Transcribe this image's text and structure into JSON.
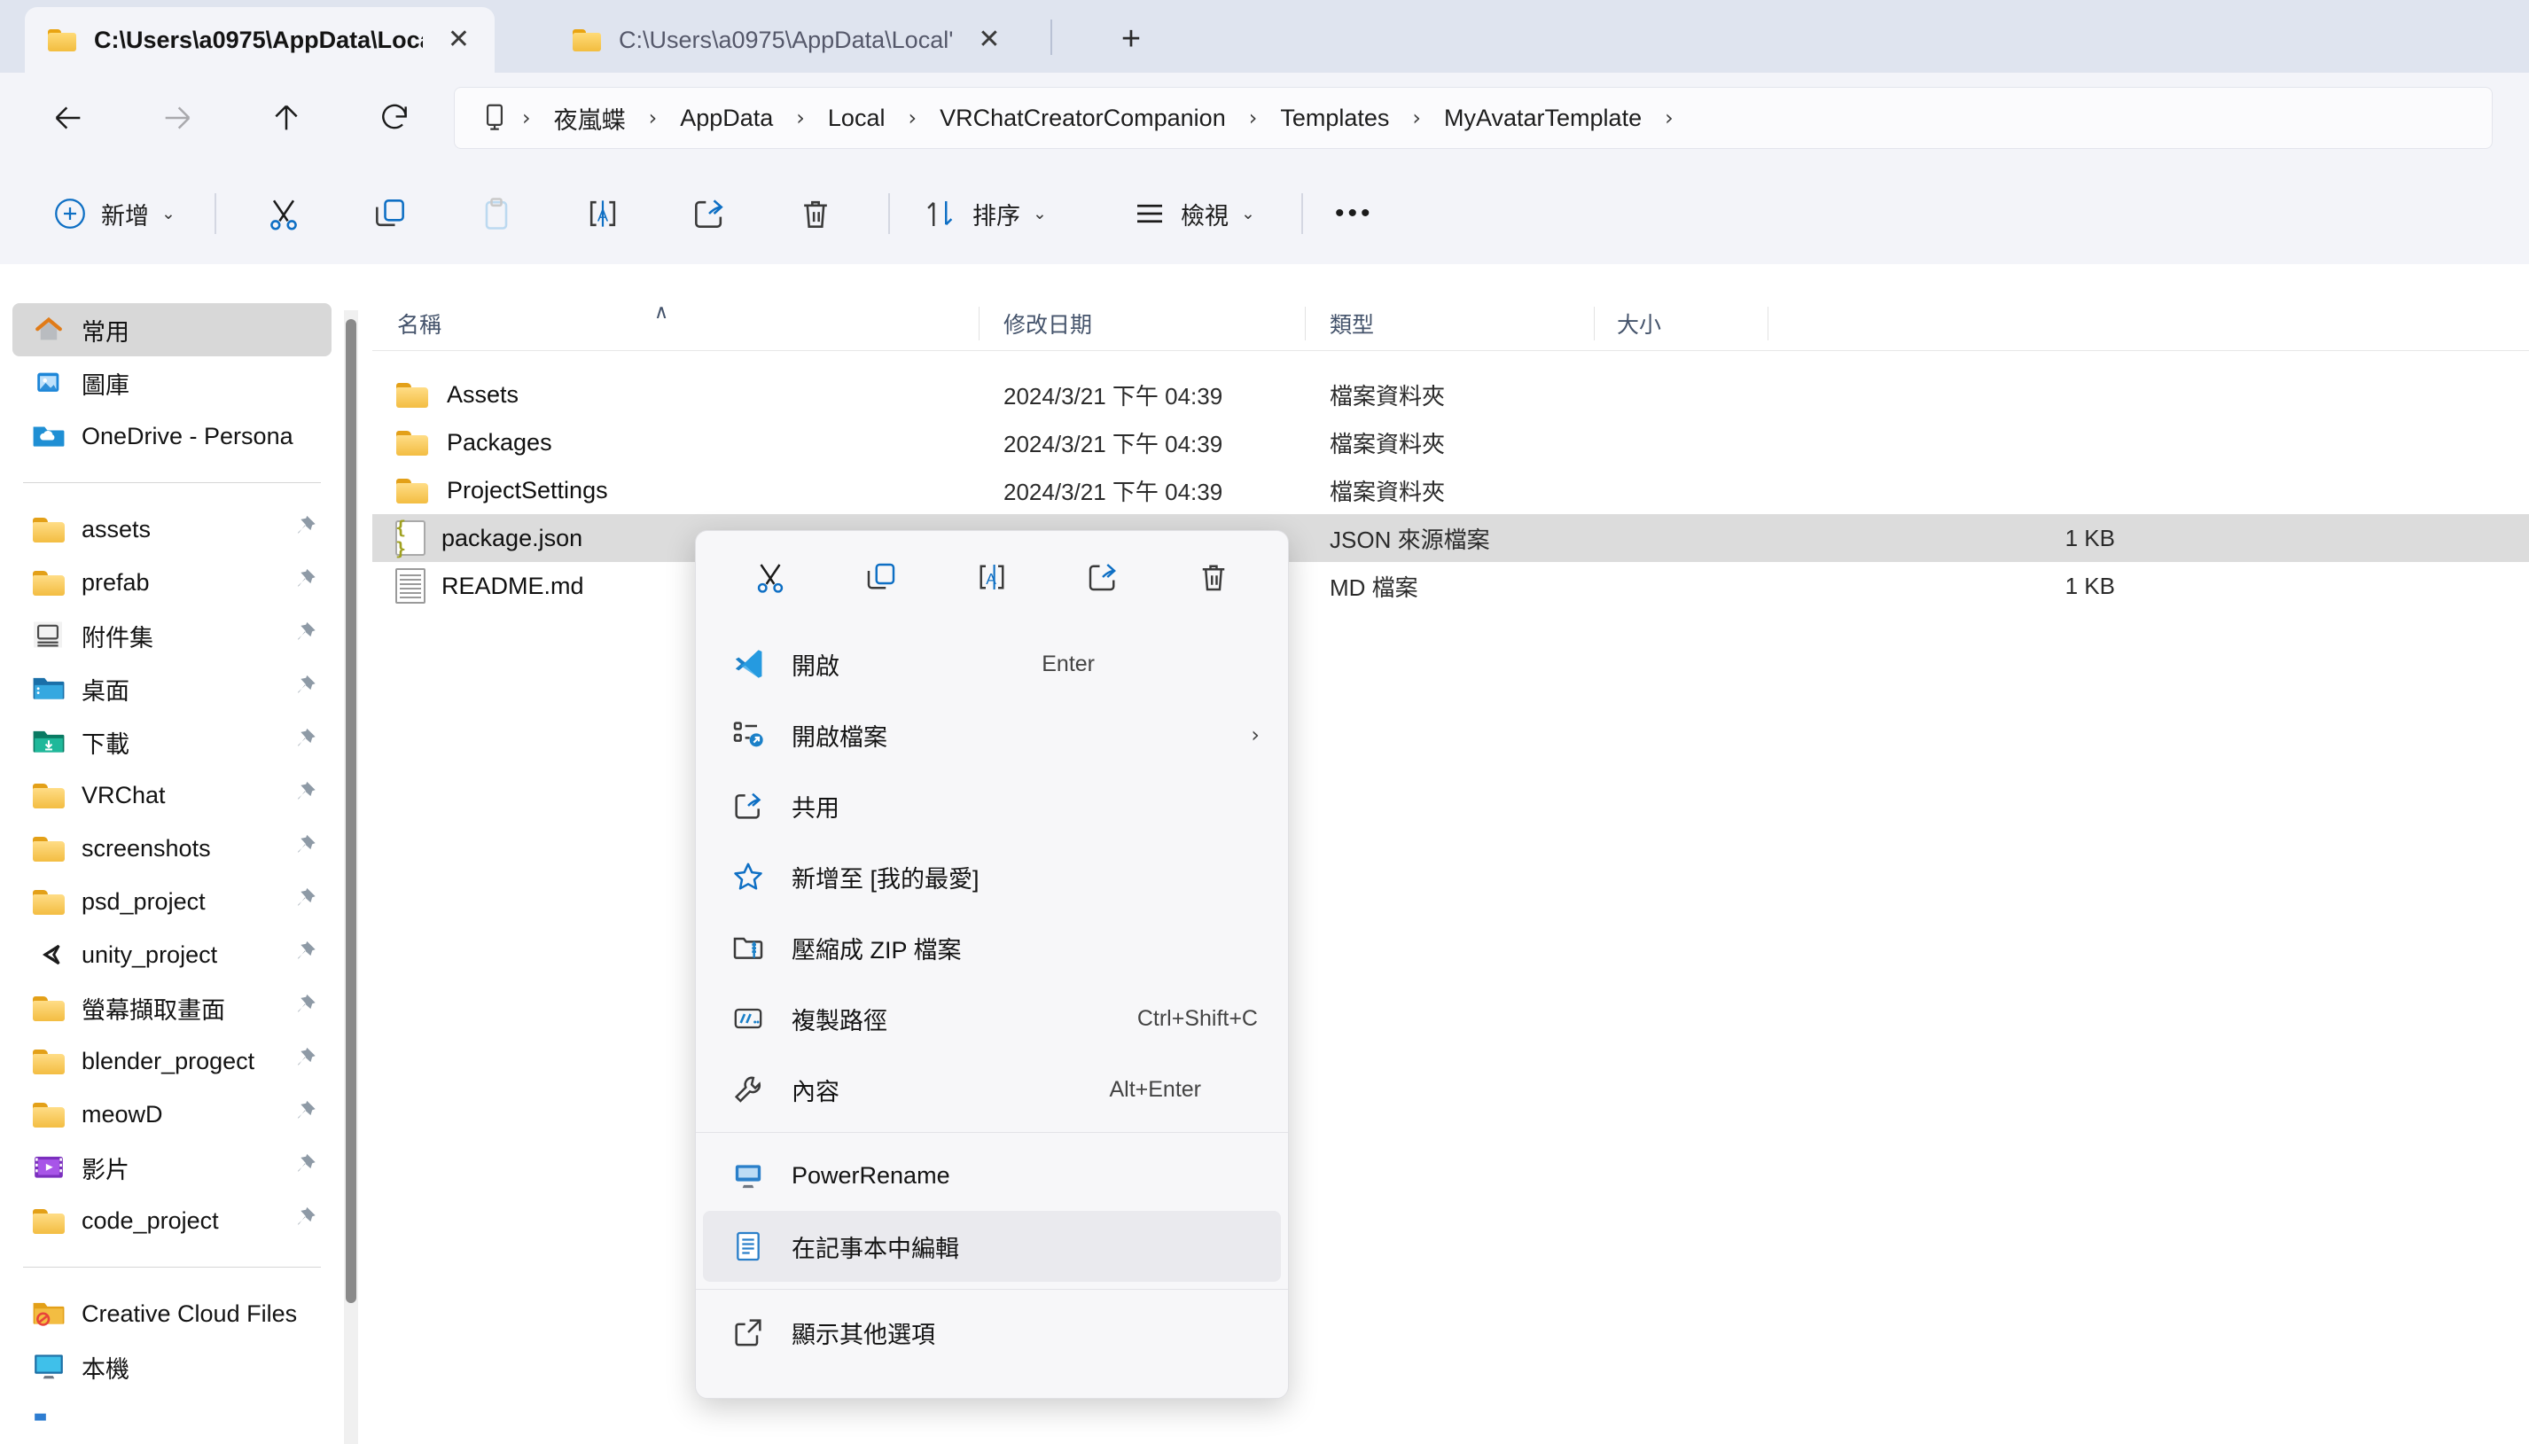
{
  "window": {
    "tabs": [
      {
        "label": "C:\\Users\\a0975\\AppData\\Loca",
        "icon": "folder-icon",
        "active": true,
        "close": "✕"
      },
      {
        "label": "C:\\Users\\a0975\\AppData\\Local'",
        "icon": "folder-icon",
        "active": false,
        "close": "✕"
      }
    ],
    "new_tab_label": "+"
  },
  "nav": {
    "back": "back-arrow",
    "forward": "forward-arrow",
    "up": "up-arrow",
    "refresh": "refresh-icon",
    "breadcrumb": [
      {
        "label": "",
        "icon": "this-pc-icon"
      },
      {
        "label": "夜嵐蝶"
      },
      {
        "label": "AppData"
      },
      {
        "label": "Local"
      },
      {
        "label": "VRChatCreatorCompanion"
      },
      {
        "label": "Templates"
      },
      {
        "label": "MyAvatarTemplate"
      }
    ],
    "separator": "›"
  },
  "toolbar": {
    "new_label": "新增",
    "new_chevron": "⌄",
    "cut_label": "剪下",
    "copy_label": "複製",
    "paste_label": "貼上",
    "rename_label": "重新命名",
    "share_label": "共用",
    "delete_label": "刪除",
    "sort_label": "排序",
    "sort_chevron": "⌄",
    "view_label": "檢視",
    "view_chevron": "⌄",
    "more_label": "•••"
  },
  "sidebar": {
    "items": [
      {
        "label": "常用",
        "icon": "home-icon",
        "selected": true,
        "pinned": false
      },
      {
        "label": "圖庫",
        "icon": "gallery-icon",
        "selected": false,
        "pinned": false
      },
      {
        "label": "OneDrive - Persona",
        "icon": "onedrive-icon",
        "selected": false,
        "pinned": false
      }
    ],
    "pinned": [
      {
        "label": "assets",
        "icon": "folder-icon",
        "pinned": true
      },
      {
        "label": "prefab",
        "icon": "folder-icon",
        "pinned": true
      },
      {
        "label": "附件集",
        "icon": "attachments-icon",
        "pinned": true
      },
      {
        "label": "桌面",
        "icon": "desktop-folder-icon",
        "pinned": true
      },
      {
        "label": "下載",
        "icon": "downloads-folder-icon",
        "pinned": true
      },
      {
        "label": "VRChat",
        "icon": "folder-icon",
        "pinned": true
      },
      {
        "label": "screenshots",
        "icon": "folder-icon",
        "pinned": true
      },
      {
        "label": "psd_project",
        "icon": "folder-icon",
        "pinned": true
      },
      {
        "label": "unity_project",
        "icon": "unity-icon",
        "pinned": true
      },
      {
        "label": "螢幕擷取畫面",
        "icon": "folder-icon",
        "pinned": true
      },
      {
        "label": "blender_progect",
        "icon": "folder-icon",
        "pinned": true
      },
      {
        "label": "meowD",
        "icon": "folder-icon",
        "pinned": true
      },
      {
        "label": "影片",
        "icon": "videos-folder-icon",
        "pinned": true
      },
      {
        "label": "code_project",
        "icon": "folder-icon",
        "pinned": true
      }
    ],
    "bottom": [
      {
        "label": "Creative Cloud Files",
        "icon": "creative-cloud-icon",
        "pinned": false
      },
      {
        "label": "本機",
        "icon": "this-pc-icon",
        "pinned": false
      }
    ]
  },
  "filelist": {
    "columns": [
      {
        "label": "名稱",
        "sort": "asc"
      },
      {
        "label": "修改日期"
      },
      {
        "label": "類型"
      },
      {
        "label": "大小"
      }
    ],
    "sort_caret": "∧",
    "rows": [
      {
        "name": "Assets",
        "icon": "folder-icon",
        "date": "2024/3/21 下午 04:39",
        "type": "檔案資料夾",
        "size": "",
        "selected": false
      },
      {
        "name": "Packages",
        "icon": "folder-icon",
        "date": "2024/3/21 下午 04:39",
        "type": "檔案資料夾",
        "size": "",
        "selected": false
      },
      {
        "name": "ProjectSettings",
        "icon": "folder-icon",
        "date": "2024/3/21 下午 04:39",
        "type": "檔案資料夾",
        "size": "",
        "selected": false
      },
      {
        "name": "package.json",
        "icon": "json-file-icon",
        "date": "",
        "type": "JSON 來源檔案",
        "size": "1 KB",
        "selected": true
      },
      {
        "name": "README.md",
        "icon": "md-file-icon",
        "date": "",
        "type": "MD 檔案",
        "size": "1 KB",
        "selected": false
      }
    ]
  },
  "context_menu": {
    "toolbar": [
      {
        "name": "cut-icon",
        "label": "剪下"
      },
      {
        "name": "copy-icon",
        "label": "複製"
      },
      {
        "name": "rename-icon",
        "label": "重新命名"
      },
      {
        "name": "share-icon",
        "label": "共用"
      },
      {
        "name": "delete-icon",
        "label": "刪除"
      }
    ],
    "items": [
      {
        "label": "開啟",
        "icon": "vscode-icon",
        "accel": "Enter",
        "submenu": false,
        "highlight": false
      },
      {
        "label": "開啟檔案",
        "icon": "open-with-icon",
        "accel": "",
        "submenu": true,
        "highlight": false
      },
      {
        "label": "共用",
        "icon": "share-icon",
        "accel": "",
        "submenu": false,
        "highlight": false
      },
      {
        "label": "新增至 [我的最愛]",
        "icon": "star-icon",
        "accel": "",
        "submenu": false,
        "highlight": false
      },
      {
        "label": "壓縮成 ZIP 檔案",
        "icon": "zip-icon",
        "accel": "",
        "submenu": false,
        "highlight": false
      },
      {
        "label": "複製路徑",
        "icon": "copy-path-icon",
        "accel": "Ctrl+Shift+C",
        "submenu": false,
        "highlight": false
      },
      {
        "label": "內容",
        "icon": "properties-icon",
        "accel": "Alt+Enter",
        "submenu": false,
        "highlight": false
      }
    ],
    "items2": [
      {
        "label": "PowerRename",
        "icon": "powerrename-icon",
        "accel": "",
        "submenu": false,
        "highlight": false
      },
      {
        "label": "在記事本中編輯",
        "icon": "notepad-icon",
        "accel": "",
        "submenu": false,
        "highlight": true
      }
    ],
    "items3": [
      {
        "label": "顯示其他選項",
        "icon": "show-more-options-icon",
        "accel": "",
        "submenu": false,
        "highlight": false
      }
    ],
    "submenu_arrow": "›"
  },
  "colors": {
    "accent": "#0078d4",
    "tabbar_bg": "#dfe4ef",
    "chrome_bg": "#f3f4f9",
    "selection": "#dcdcdc",
    "folder_yellow": "#f3bd42"
  }
}
